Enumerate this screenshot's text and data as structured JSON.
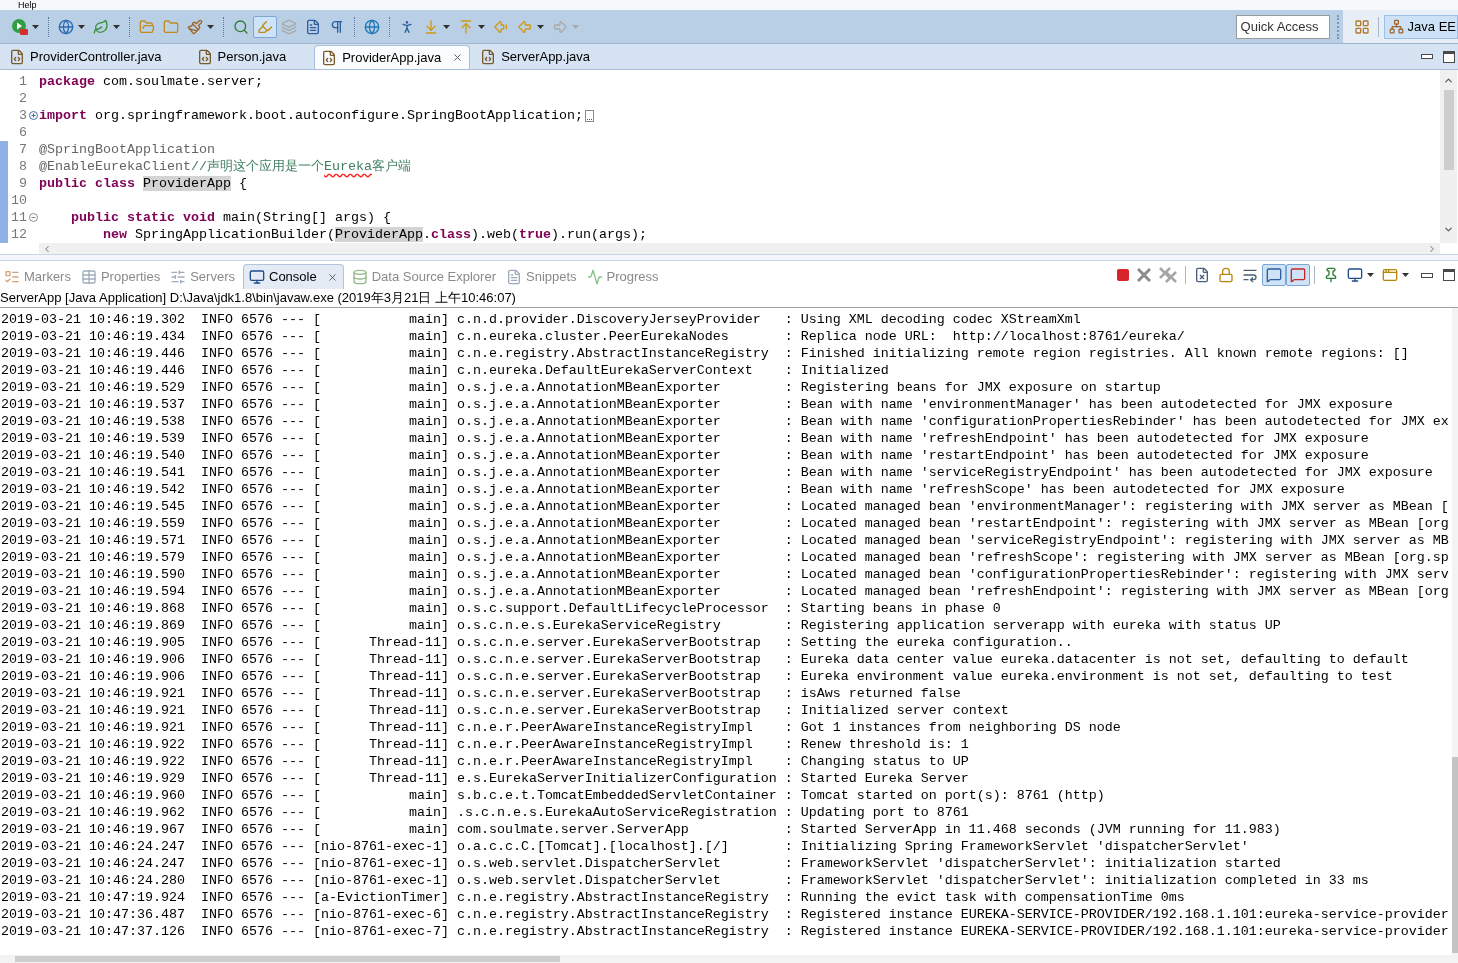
{
  "menu_bar": {
    "items": [
      {
        "label": "Help"
      }
    ]
  },
  "toolbar": {
    "groups": [
      {
        "buttons": [
          {
            "kind": "run",
            "dropdown": true,
            "pressed": false,
            "disabled": false
          }
        ]
      },
      {
        "buttons": [
          {
            "kind": "new-server",
            "dropdown": true,
            "pressed": false,
            "disabled": false
          },
          {
            "kind": "spring",
            "dropdown": true,
            "pressed": false,
            "disabled": false
          }
        ]
      },
      {
        "buttons": [
          {
            "kind": "open-type",
            "dropdown": false,
            "pressed": false,
            "disabled": false
          },
          {
            "kind": "open-task",
            "dropdown": false,
            "pressed": false,
            "disabled": false
          },
          {
            "kind": "brush",
            "dropdown": true,
            "pressed": false,
            "disabled": false
          }
        ]
      },
      {
        "buttons": [
          {
            "kind": "search",
            "dropdown": false,
            "pressed": false,
            "disabled": false
          },
          {
            "kind": "highlight",
            "dropdown": false,
            "pressed": true,
            "disabled": false
          },
          {
            "kind": "layers",
            "dropdown": false,
            "pressed": false,
            "disabled": true
          },
          {
            "kind": "document",
            "dropdown": false,
            "pressed": false,
            "disabled": false
          },
          {
            "kind": "pilcrow",
            "dropdown": false,
            "pressed": false,
            "disabled": false
          }
        ]
      },
      {
        "buttons": [
          {
            "kind": "globe",
            "dropdown": false,
            "pressed": false,
            "disabled": false
          }
        ]
      },
      {
        "buttons": [
          {
            "kind": "person",
            "dropdown": false,
            "pressed": false,
            "disabled": false
          },
          {
            "kind": "next",
            "dropdown": true,
            "pressed": false,
            "disabled": false
          },
          {
            "kind": "previous",
            "dropdown": true,
            "pressed": false,
            "disabled": false
          },
          {
            "kind": "last-edit",
            "dropdown": false,
            "pressed": false,
            "disabled": false
          },
          {
            "kind": "back",
            "dropdown": true,
            "pressed": false,
            "disabled": false
          },
          {
            "kind": "forward",
            "dropdown": true,
            "pressed": false,
            "disabled": true
          }
        ]
      }
    ],
    "quick_access": {
      "placeholder": "Quick Access"
    },
    "perspectives": [
      {
        "label": "Java EE",
        "selected": true
      }
    ]
  },
  "editor": {
    "tabs": [
      {
        "label": "ProviderController.java",
        "selected": false
      },
      {
        "label": "Person.java",
        "selected": false
      },
      {
        "label": "ProviderApp.java",
        "selected": true
      },
      {
        "label": "ServerApp.java",
        "selected": false
      }
    ],
    "lines": [
      {
        "number": "1",
        "changed": false,
        "tokens": [
          {
            "kind": "keyword",
            "text": "package"
          },
          {
            "kind": "plain",
            "text": " com.soulmate.server;"
          }
        ]
      },
      {
        "number": "2",
        "changed": false
      },
      {
        "number": "3",
        "changed": false,
        "collapsed": true,
        "tokens": [
          {
            "kind": "keyword",
            "text": "import"
          },
          {
            "kind": "plain",
            "text": " org.springframework.boot.autoconfigure.SpringBootApplication;"
          }
        ]
      },
      {
        "number": "6",
        "changed": false
      },
      {
        "number": "7",
        "changed": true,
        "tokens": [
          {
            "kind": "annotation",
            "text": "@SpringBootApplication"
          }
        ]
      },
      {
        "number": "8",
        "changed": true,
        "tokens": [
          {
            "kind": "annotation",
            "text": "@EnableEurekaClient"
          },
          {
            "kind": "comment",
            "text": "//声明这个应用是一个"
          },
          {
            "kind": "misspelled",
            "text": "Eureka"
          },
          {
            "kind": "comment",
            "text": "客户端"
          }
        ]
      },
      {
        "number": "9",
        "changed": true,
        "tokens": [
          {
            "kind": "keyword",
            "text": "public class "
          },
          {
            "kind": "occurrence",
            "text": "ProviderApp"
          },
          {
            "kind": "plain",
            "text": " {"
          }
        ]
      },
      {
        "number": "10",
        "changed": true
      },
      {
        "number": "11",
        "changed": true,
        "collapsed": false,
        "tokens": [
          {
            "kind": "keyword",
            "text": "    public static void"
          },
          {
            "kind": "plain",
            "text": " main(String[] args) {"
          }
        ]
      },
      {
        "number": "12",
        "changed": true,
        "tokens": [
          {
            "kind": "keyword",
            "text": "        new"
          },
          {
            "kind": "plain",
            "text": " SpringApplicationBuilder("
          },
          {
            "kind": "occurrence",
            "text": "ProviderApp"
          },
          {
            "kind": "plain",
            "text": "."
          },
          {
            "kind": "keyword",
            "text": "class"
          },
          {
            "kind": "plain",
            "text": ").web("
          },
          {
            "kind": "keyword",
            "text": "true"
          },
          {
            "kind": "plain",
            "text": ").run(args);"
          }
        ]
      }
    ]
  },
  "console": {
    "tabs": [
      {
        "kind": "markers",
        "label": "Markers",
        "selected": false
      },
      {
        "kind": "properties",
        "label": "Properties",
        "selected": false
      },
      {
        "kind": "servers",
        "label": "Servers",
        "selected": false
      },
      {
        "kind": "console",
        "label": "Console",
        "selected": true
      },
      {
        "kind": "data-source",
        "label": "Data Source Explorer",
        "selected": false
      },
      {
        "kind": "snippets",
        "label": "Snippets",
        "selected": false
      },
      {
        "kind": "progress",
        "label": "Progress",
        "selected": false
      }
    ],
    "toolbar": {
      "groups": [
        {
          "buttons": [
            {
              "kind": "terminate",
              "dropdown": false,
              "pressed": false
            },
            {
              "kind": "remove-launch",
              "dropdown": false,
              "pressed": false
            },
            {
              "kind": "remove-all",
              "dropdown": false,
              "pressed": false
            }
          ]
        },
        {
          "buttons": [
            {
              "kind": "clear",
              "dropdown": false,
              "pressed": false
            },
            {
              "kind": "scroll-lock",
              "dropdown": false,
              "pressed": false
            },
            {
              "kind": "word-wrap",
              "dropdown": false,
              "pressed": false
            },
            {
              "kind": "show-stdout",
              "dropdown": false,
              "pressed": true
            },
            {
              "kind": "show-stderr",
              "dropdown": false,
              "pressed": true
            }
          ]
        },
        {
          "buttons": [
            {
              "kind": "pin",
              "dropdown": false,
              "pressed": false
            },
            {
              "kind": "display-console",
              "dropdown": true,
              "pressed": false
            },
            {
              "kind": "open-console",
              "dropdown": true,
              "pressed": false
            }
          ]
        }
      ]
    },
    "title": "ServerApp [Java Application] D:\\Java\\jdk1.8\\bin\\javaw.exe (2019年3月21日 上午10:46:07)",
    "lines": [
      "2019-03-21 10:46:19.302  INFO 6576 --- [           main] c.n.d.provider.DiscoveryJerseyProvider   : Using XML decoding codec XStreamXml",
      "2019-03-21 10:46:19.434  INFO 6576 --- [           main] c.n.eureka.cluster.PeerEurekaNodes       : Replica node URL:  http://localhost:8761/eureka/",
      "2019-03-21 10:46:19.446  INFO 6576 --- [           main] c.n.e.registry.AbstractInstanceRegistry  : Finished initializing remote region registries. All known remote regions: []",
      "2019-03-21 10:46:19.446  INFO 6576 --- [           main] c.n.eureka.DefaultEurekaServerContext    : Initialized",
      "2019-03-21 10:46:19.529  INFO 6576 --- [           main] o.s.j.e.a.AnnotationMBeanExporter        : Registering beans for JMX exposure on startup",
      "2019-03-21 10:46:19.537  INFO 6576 --- [           main] o.s.j.e.a.AnnotationMBeanExporter        : Bean with name 'environmentManager' has been autodetected for JMX exposure",
      "2019-03-21 10:46:19.538  INFO 6576 --- [           main] o.s.j.e.a.AnnotationMBeanExporter        : Bean with name 'configurationPropertiesRebinder' has been autodetected for JMX ex",
      "2019-03-21 10:46:19.539  INFO 6576 --- [           main] o.s.j.e.a.AnnotationMBeanExporter        : Bean with name 'refreshEndpoint' has been autodetected for JMX exposure",
      "2019-03-21 10:46:19.540  INFO 6576 --- [           main] o.s.j.e.a.AnnotationMBeanExporter        : Bean with name 'restartEndpoint' has been autodetected for JMX exposure",
      "2019-03-21 10:46:19.541  INFO 6576 --- [           main] o.s.j.e.a.AnnotationMBeanExporter        : Bean with name 'serviceRegistryEndpoint' has been autodetected for JMX exposure",
      "2019-03-21 10:46:19.542  INFO 6576 --- [           main] o.s.j.e.a.AnnotationMBeanExporter        : Bean with name 'refreshScope' has been autodetected for JMX exposure",
      "2019-03-21 10:46:19.545  INFO 6576 --- [           main] o.s.j.e.a.AnnotationMBeanExporter        : Located managed bean 'environmentManager': registering with JMX server as MBean [",
      "2019-03-21 10:46:19.559  INFO 6576 --- [           main] o.s.j.e.a.AnnotationMBeanExporter        : Located managed bean 'restartEndpoint': registering with JMX server as MBean [org",
      "2019-03-21 10:46:19.571  INFO 6576 --- [           main] o.s.j.e.a.AnnotationMBeanExporter        : Located managed bean 'serviceRegistryEndpoint': registering with JMX server as MB",
      "2019-03-21 10:46:19.579  INFO 6576 --- [           main] o.s.j.e.a.AnnotationMBeanExporter        : Located managed bean 'refreshScope': registering with JMX server as MBean [org.sp",
      "2019-03-21 10:46:19.590  INFO 6576 --- [           main] o.s.j.e.a.AnnotationMBeanExporter        : Located managed bean 'configurationPropertiesRebinder': registering with JMX serv",
      "2019-03-21 10:46:19.594  INFO 6576 --- [           main] o.s.j.e.a.AnnotationMBeanExporter        : Located managed bean 'refreshEndpoint': registering with JMX server as MBean [org",
      "2019-03-21 10:46:19.868  INFO 6576 --- [           main] o.s.c.support.DefaultLifecycleProcessor  : Starting beans in phase 0",
      "2019-03-21 10:46:19.869  INFO 6576 --- [           main] o.s.c.n.e.s.EurekaServiceRegistry        : Registering application serverapp with eureka with status UP",
      "2019-03-21 10:46:19.905  INFO 6576 --- [      Thread-11] o.s.c.n.e.server.EurekaServerBootstrap   : Setting the eureka configuration..",
      "2019-03-21 10:46:19.906  INFO 6576 --- [      Thread-11] o.s.c.n.e.server.EurekaServerBootstrap   : Eureka data center value eureka.datacenter is not set, defaulting to default",
      "2019-03-21 10:46:19.906  INFO 6576 --- [      Thread-11] o.s.c.n.e.server.EurekaServerBootstrap   : Eureka environment value eureka.environment is not set, defaulting to test",
      "2019-03-21 10:46:19.921  INFO 6576 --- [      Thread-11] o.s.c.n.e.server.EurekaServerBootstrap   : isAws returned false",
      "2019-03-21 10:46:19.921  INFO 6576 --- [      Thread-11] o.s.c.n.e.server.EurekaServerBootstrap   : Initialized server context",
      "2019-03-21 10:46:19.921  INFO 6576 --- [      Thread-11] c.n.e.r.PeerAwareInstanceRegistryImpl    : Got 1 instances from neighboring DS node",
      "2019-03-21 10:46:19.922  INFO 6576 --- [      Thread-11] c.n.e.r.PeerAwareInstanceRegistryImpl    : Renew threshold is: 1",
      "2019-03-21 10:46:19.922  INFO 6576 --- [      Thread-11] c.n.e.r.PeerAwareInstanceRegistryImpl    : Changing status to UP",
      "2019-03-21 10:46:19.929  INFO 6576 --- [      Thread-11] e.s.EurekaServerInitializerConfiguration : Started Eureka Server",
      "2019-03-21 10:46:19.960  INFO 6576 --- [           main] s.b.c.e.t.TomcatEmbeddedServletContainer : Tomcat started on port(s): 8761 (http)",
      "2019-03-21 10:46:19.962  INFO 6576 --- [           main] .s.c.n.e.s.EurekaAutoServiceRegistration : Updating port to 8761",
      "2019-03-21 10:46:19.967  INFO 6576 --- [           main] com.soulmate.server.ServerApp            : Started ServerApp in 11.468 seconds (JVM running for 11.983)",
      "2019-03-21 10:46:24.247  INFO 6576 --- [nio-8761-exec-1] o.a.c.c.C.[Tomcat].[localhost].[/]       : Initializing Spring FrameworkServlet 'dispatcherServlet'",
      "2019-03-21 10:46:24.247  INFO 6576 --- [nio-8761-exec-1] o.s.web.servlet.DispatcherServlet        : FrameworkServlet 'dispatcherServlet': initialization started",
      "2019-03-21 10:46:24.280  INFO 6576 --- [nio-8761-exec-1] o.s.web.servlet.DispatcherServlet        : FrameworkServlet 'dispatcherServlet': initialization completed in 33 ms",
      "2019-03-21 10:47:19.924  INFO 6576 --- [a-EvictionTimer] c.n.e.registry.AbstractInstanceRegistry  : Running the evict task with compensationTime 0ms",
      "2019-03-21 10:47:36.487  INFO 6576 --- [nio-8761-exec-6] c.n.e.registry.AbstractInstanceRegistry  : Registered instance EUREKA-SERVICE-PROVIDER/192.168.1.101:eureka-service-provider",
      "2019-03-21 10:47:37.126  INFO 6576 --- [nio-8761-exec-7] c.n.e.registry.AbstractInstanceRegistry  : Registered instance EUREKA-SERVICE-PROVIDER/192.168.1.101:eureka-service-provider"
    ]
  }
}
